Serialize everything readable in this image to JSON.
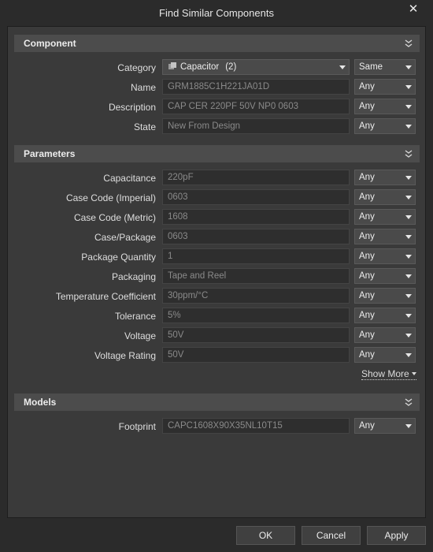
{
  "window": {
    "title": "Find Similar Components"
  },
  "sections": {
    "component": "Component",
    "parameters": "Parameters",
    "models": "Models"
  },
  "component_rows": [
    {
      "label": "Category",
      "value": "Capacitor",
      "count": "(2)",
      "match": "Same"
    },
    {
      "label": "Name",
      "value": "GRM1885C1H221JA01D",
      "match": "Any"
    },
    {
      "label": "Description",
      "value": "CAP CER 220PF 50V NP0 0603",
      "match": "Any"
    },
    {
      "label": "State",
      "value": "New From Design",
      "match": "Any"
    }
  ],
  "parameter_rows": [
    {
      "label": "Capacitance",
      "value": "220pF",
      "match": "Any"
    },
    {
      "label": "Case Code (Imperial)",
      "value": "0603",
      "match": "Any"
    },
    {
      "label": "Case Code (Metric)",
      "value": "1608",
      "match": "Any"
    },
    {
      "label": "Case/Package",
      "value": "0603",
      "match": "Any"
    },
    {
      "label": "Package Quantity",
      "value": "1",
      "match": "Any"
    },
    {
      "label": "Packaging",
      "value": "Tape and Reel",
      "match": "Any"
    },
    {
      "label": "Temperature Coefficient",
      "value": "30ppm/°C",
      "match": "Any"
    },
    {
      "label": "Tolerance",
      "value": "5%",
      "match": "Any"
    },
    {
      "label": "Voltage",
      "value": "50V",
      "match": "Any"
    },
    {
      "label": "Voltage Rating",
      "value": "50V",
      "match": "Any"
    }
  ],
  "show_more": "Show More",
  "model_rows": [
    {
      "label": "Footprint",
      "value": "CAPC1608X90X35NL10T15",
      "match": "Any"
    }
  ],
  "buttons": {
    "ok": "OK",
    "cancel": "Cancel",
    "apply": "Apply"
  },
  "colors": {
    "background": "#2b2b2b",
    "panel": "#3a3a3a",
    "section_header": "#4c4c4c"
  }
}
